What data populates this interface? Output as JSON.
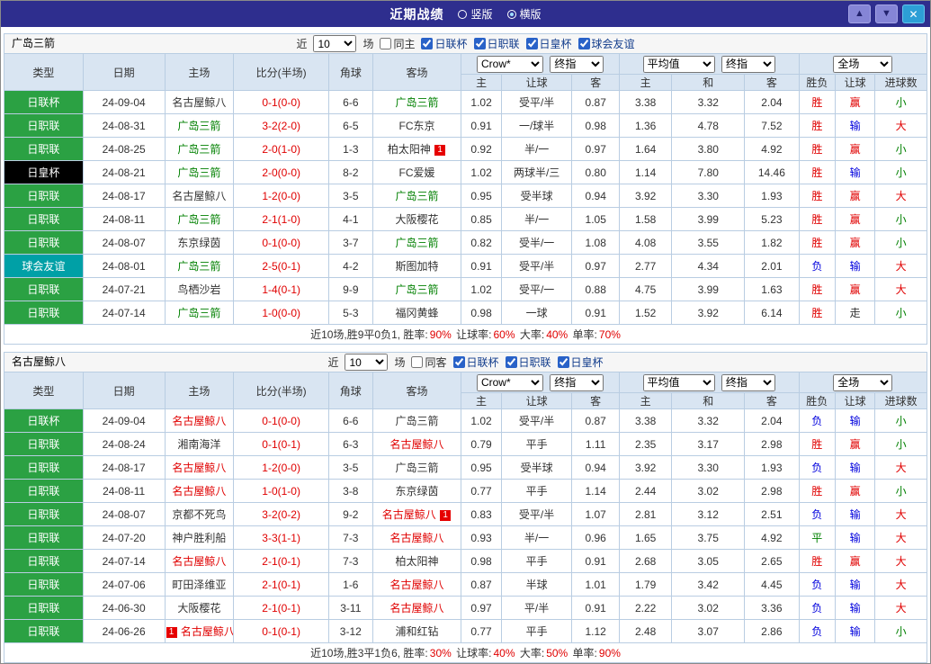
{
  "topbar": {
    "title": "近期战绩",
    "radio_vertical": "竖版",
    "radio_horizontal": "横版",
    "selected_radio": "横版",
    "up_icon": "▲",
    "down_icon": "▼",
    "close_icon": "✕"
  },
  "colors": {
    "titlebar_bg": "#2e2e8e",
    "header_bg": "#d9e5f2",
    "win_red": "#e00000",
    "loss_blue": "#0000dd",
    "draw_green": "#008000",
    "league_green": "#2ba143",
    "cup_black": "#000000",
    "friendly_teal": "#00a0a6"
  },
  "shared": {
    "near_label": "近",
    "near_value": "10",
    "matches_label": "场",
    "dropdowns": [
      "Crow*",
      "终指",
      "平均值",
      "终指",
      "全场"
    ],
    "columns": [
      "类型",
      "日期",
      "主场",
      "比分(半场)",
      "角球",
      "客场"
    ],
    "odds_columns": [
      "主",
      "让球",
      "客",
      "主",
      "和",
      "客"
    ],
    "result_columns": [
      "胜负",
      "让球",
      "进球数"
    ]
  },
  "tables": [
    {
      "team": "广岛三箭",
      "same_side_label": "同主",
      "same_side_checked": false,
      "league_filters": [
        {
          "label": "日联杯",
          "checked": true
        },
        {
          "label": "日职联",
          "checked": true
        },
        {
          "label": "日皇杯",
          "checked": true
        },
        {
          "label": "球会友谊",
          "checked": true
        }
      ],
      "rows": [
        {
          "type": "日联杯",
          "type_bg": "#2ba143",
          "date": "24-09-04",
          "home": "名古屋鲸八",
          "home_color": "#333333",
          "score": "0-1(0-0)",
          "corner": "6-6",
          "away": "广岛三箭",
          "away_color": "#008000",
          "odds": [
            "1.02",
            "受平/半",
            "0.87",
            "3.38",
            "3.32",
            "2.04"
          ],
          "result": "胜",
          "result_color": "#e00000",
          "cover": "赢",
          "cover_color": "#e00000",
          "goals": "小",
          "goals_color": "#008000"
        },
        {
          "type": "日职联",
          "type_bg": "#2ba143",
          "date": "24-08-31",
          "home": "广岛三箭",
          "home_color": "#008000",
          "score": "3-2(2-0)",
          "corner": "6-5",
          "away": "FC东京",
          "away_color": "#333333",
          "odds": [
            "0.91",
            "一/球半",
            "0.98",
            "1.36",
            "4.78",
            "7.52"
          ],
          "result": "胜",
          "result_color": "#e00000",
          "cover": "输",
          "cover_color": "#0000dd",
          "goals": "大",
          "goals_color": "#e00000"
        },
        {
          "type": "日职联",
          "type_bg": "#2ba143",
          "date": "24-08-25",
          "home": "广岛三箭",
          "home_color": "#008000",
          "score": "2-0(1-0)",
          "corner": "1-3",
          "away": "柏太阳神",
          "away_color": "#333333",
          "away_badge": {
            "text": "1",
            "pos": "after"
          },
          "odds": [
            "0.92",
            "半/一",
            "0.97",
            "1.64",
            "3.80",
            "4.92"
          ],
          "result": "胜",
          "result_color": "#e00000",
          "cover": "赢",
          "cover_color": "#e00000",
          "goals": "小",
          "goals_color": "#008000"
        },
        {
          "type": "日皇杯",
          "type_bg": "#000000",
          "date": "24-08-21",
          "home": "广岛三箭",
          "home_color": "#008000",
          "score": "2-0(0-0)",
          "corner": "8-2",
          "away": "FC爱媛",
          "away_color": "#333333",
          "odds": [
            "1.02",
            "两球半/三",
            "0.80",
            "1.14",
            "7.80",
            "14.46"
          ],
          "result": "胜",
          "result_color": "#e00000",
          "cover": "输",
          "cover_color": "#0000dd",
          "goals": "小",
          "goals_color": "#008000"
        },
        {
          "type": "日职联",
          "type_bg": "#2ba143",
          "date": "24-08-17",
          "home": "名古屋鲸八",
          "home_color": "#333333",
          "score": "1-2(0-0)",
          "corner": "3-5",
          "away": "广岛三箭",
          "away_color": "#008000",
          "odds": [
            "0.95",
            "受半球",
            "0.94",
            "3.92",
            "3.30",
            "1.93"
          ],
          "result": "胜",
          "result_color": "#e00000",
          "cover": "赢",
          "cover_color": "#e00000",
          "goals": "大",
          "goals_color": "#e00000"
        },
        {
          "type": "日职联",
          "type_bg": "#2ba143",
          "date": "24-08-11",
          "home": "广岛三箭",
          "home_color": "#008000",
          "score": "2-1(1-0)",
          "corner": "4-1",
          "away": "大阪樱花",
          "away_color": "#333333",
          "odds": [
            "0.85",
            "半/一",
            "1.05",
            "1.58",
            "3.99",
            "5.23"
          ],
          "result": "胜",
          "result_color": "#e00000",
          "cover": "赢",
          "cover_color": "#e00000",
          "goals": "小",
          "goals_color": "#008000"
        },
        {
          "type": "日职联",
          "type_bg": "#2ba143",
          "date": "24-08-07",
          "home": "东京绿茵",
          "home_color": "#333333",
          "score": "0-1(0-0)",
          "corner": "3-7",
          "away": "广岛三箭",
          "away_color": "#008000",
          "odds": [
            "0.82",
            "受半/一",
            "1.08",
            "4.08",
            "3.55",
            "1.82"
          ],
          "result": "胜",
          "result_color": "#e00000",
          "cover": "赢",
          "cover_color": "#e00000",
          "goals": "小",
          "goals_color": "#008000"
        },
        {
          "type": "球会友谊",
          "type_bg": "#00a0a6",
          "date": "24-08-01",
          "home": "广岛三箭",
          "home_color": "#008000",
          "score": "2-5(0-1)",
          "corner": "4-2",
          "away": "斯图加特",
          "away_color": "#333333",
          "odds": [
            "0.91",
            "受平/半",
            "0.97",
            "2.77",
            "4.34",
            "2.01"
          ],
          "result": "负",
          "result_color": "#0000dd",
          "cover": "输",
          "cover_color": "#0000dd",
          "goals": "大",
          "goals_color": "#e00000"
        },
        {
          "type": "日职联",
          "type_bg": "#2ba143",
          "date": "24-07-21",
          "home": "鸟栖沙岩",
          "home_color": "#333333",
          "score": "1-4(0-1)",
          "corner": "9-9",
          "away": "广岛三箭",
          "away_color": "#008000",
          "odds": [
            "1.02",
            "受平/一",
            "0.88",
            "4.75",
            "3.99",
            "1.63"
          ],
          "result": "胜",
          "result_color": "#e00000",
          "cover": "赢",
          "cover_color": "#e00000",
          "goals": "大",
          "goals_color": "#e00000"
        },
        {
          "type": "日职联",
          "type_bg": "#2ba143",
          "date": "24-07-14",
          "home": "广岛三箭",
          "home_color": "#008000",
          "score": "1-0(0-0)",
          "corner": "5-3",
          "away": "福冈黄蜂",
          "away_color": "#333333",
          "odds": [
            "0.98",
            "一球",
            "0.91",
            "1.52",
            "3.92",
            "6.14"
          ],
          "result": "胜",
          "result_color": "#e00000",
          "cover": "走",
          "cover_color": "#333333",
          "goals": "小",
          "goals_color": "#008000"
        }
      ],
      "summary": [
        {
          "text": "近10场,胜9平0负1, 胜率:",
          "color": "#333333"
        },
        {
          "text": "90%",
          "color": "#e00000"
        },
        {
          "text": " 让球率:",
          "color": "#333333"
        },
        {
          "text": "60%",
          "color": "#e00000"
        },
        {
          "text": " 大率:",
          "color": "#333333"
        },
        {
          "text": "40%",
          "color": "#e00000"
        },
        {
          "text": " 单率:",
          "color": "#333333"
        },
        {
          "text": "70%",
          "color": "#e00000"
        }
      ]
    },
    {
      "team": "名古屋鲸八",
      "same_side_label": "同客",
      "same_side_checked": false,
      "league_filters": [
        {
          "label": "日联杯",
          "checked": true
        },
        {
          "label": "日职联",
          "checked": true
        },
        {
          "label": "日皇杯",
          "checked": true
        }
      ],
      "rows": [
        {
          "type": "日联杯",
          "type_bg": "#2ba143",
          "date": "24-09-04",
          "home": "名古屋鲸八",
          "home_color": "#e00000",
          "score": "0-1(0-0)",
          "corner": "6-6",
          "away": "广岛三箭",
          "away_color": "#333333",
          "odds": [
            "1.02",
            "受平/半",
            "0.87",
            "3.38",
            "3.32",
            "2.04"
          ],
          "result": "负",
          "result_color": "#0000dd",
          "cover": "输",
          "cover_color": "#0000dd",
          "goals": "小",
          "goals_color": "#008000"
        },
        {
          "type": "日职联",
          "type_bg": "#2ba143",
          "date": "24-08-24",
          "home": "湘南海洋",
          "home_color": "#333333",
          "score": "0-1(0-1)",
          "corner": "6-3",
          "away": "名古屋鲸八",
          "away_color": "#e00000",
          "odds": [
            "0.79",
            "平手",
            "1.11",
            "2.35",
            "3.17",
            "2.98"
          ],
          "result": "胜",
          "result_color": "#e00000",
          "cover": "赢",
          "cover_color": "#e00000",
          "goals": "小",
          "goals_color": "#008000"
        },
        {
          "type": "日职联",
          "type_bg": "#2ba143",
          "date": "24-08-17",
          "home": "名古屋鲸八",
          "home_color": "#e00000",
          "score": "1-2(0-0)",
          "corner": "3-5",
          "away": "广岛三箭",
          "away_color": "#333333",
          "odds": [
            "0.95",
            "受半球",
            "0.94",
            "3.92",
            "3.30",
            "1.93"
          ],
          "result": "负",
          "result_color": "#0000dd",
          "cover": "输",
          "cover_color": "#0000dd",
          "goals": "大",
          "goals_color": "#e00000"
        },
        {
          "type": "日职联",
          "type_bg": "#2ba143",
          "date": "24-08-11",
          "home": "名古屋鲸八",
          "home_color": "#e00000",
          "score": "1-0(1-0)",
          "corner": "3-8",
          "away": "东京绿茵",
          "away_color": "#333333",
          "odds": [
            "0.77",
            "平手",
            "1.14",
            "2.44",
            "3.02",
            "2.98"
          ],
          "result": "胜",
          "result_color": "#e00000",
          "cover": "赢",
          "cover_color": "#e00000",
          "goals": "小",
          "goals_color": "#008000"
        },
        {
          "type": "日职联",
          "type_bg": "#2ba143",
          "date": "24-08-07",
          "home": "京都不死鸟",
          "home_color": "#333333",
          "score": "3-2(0-2)",
          "corner": "9-2",
          "away": "名古屋鲸八",
          "away_color": "#e00000",
          "away_badge": {
            "text": "1",
            "pos": "after"
          },
          "odds": [
            "0.83",
            "受平/半",
            "1.07",
            "2.81",
            "3.12",
            "2.51"
          ],
          "result": "负",
          "result_color": "#0000dd",
          "cover": "输",
          "cover_color": "#0000dd",
          "goals": "大",
          "goals_color": "#e00000"
        },
        {
          "type": "日职联",
          "type_bg": "#2ba143",
          "date": "24-07-20",
          "home": "神户胜利船",
          "home_color": "#333333",
          "score": "3-3(1-1)",
          "corner": "7-3",
          "away": "名古屋鲸八",
          "away_color": "#e00000",
          "odds": [
            "0.93",
            "半/一",
            "0.96",
            "1.65",
            "3.75",
            "4.92"
          ],
          "result": "平",
          "result_color": "#008000",
          "cover": "输",
          "cover_color": "#0000dd",
          "goals": "大",
          "goals_color": "#e00000"
        },
        {
          "type": "日职联",
          "type_bg": "#2ba143",
          "date": "24-07-14",
          "home": "名古屋鲸八",
          "home_color": "#e00000",
          "score": "2-1(0-1)",
          "corner": "7-3",
          "away": "柏太阳神",
          "away_color": "#333333",
          "odds": [
            "0.98",
            "平手",
            "0.91",
            "2.68",
            "3.05",
            "2.65"
          ],
          "result": "胜",
          "result_color": "#e00000",
          "cover": "赢",
          "cover_color": "#e00000",
          "goals": "大",
          "goals_color": "#e00000"
        },
        {
          "type": "日职联",
          "type_bg": "#2ba143",
          "date": "24-07-06",
          "home": "町田泽维亚",
          "home_color": "#333333",
          "score": "2-1(0-1)",
          "corner": "1-6",
          "away": "名古屋鲸八",
          "away_color": "#e00000",
          "odds": [
            "0.87",
            "半球",
            "1.01",
            "1.79",
            "3.42",
            "4.45"
          ],
          "result": "负",
          "result_color": "#0000dd",
          "cover": "输",
          "cover_color": "#0000dd",
          "goals": "大",
          "goals_color": "#e00000"
        },
        {
          "type": "日职联",
          "type_bg": "#2ba143",
          "date": "24-06-30",
          "home": "大阪樱花",
          "home_color": "#333333",
          "score": "2-1(0-1)",
          "corner": "3-11",
          "away": "名古屋鲸八",
          "away_color": "#e00000",
          "odds": [
            "0.97",
            "平/半",
            "0.91",
            "2.22",
            "3.02",
            "3.36"
          ],
          "result": "负",
          "result_color": "#0000dd",
          "cover": "输",
          "cover_color": "#0000dd",
          "goals": "大",
          "goals_color": "#e00000"
        },
        {
          "type": "日职联",
          "type_bg": "#2ba143",
          "date": "24-06-26",
          "home": "名古屋鲸八",
          "home_color": "#e00000",
          "home_badge": {
            "text": "1",
            "pos": "before"
          },
          "score": "0-1(0-1)",
          "corner": "3-12",
          "away": "浦和红钻",
          "away_color": "#333333",
          "odds": [
            "0.77",
            "平手",
            "1.12",
            "2.48",
            "3.07",
            "2.86"
          ],
          "result": "负",
          "result_color": "#0000dd",
          "cover": "输",
          "cover_color": "#0000dd",
          "goals": "小",
          "goals_color": "#008000"
        }
      ],
      "summary": [
        {
          "text": "近10场,胜3平1负6, 胜率:",
          "color": "#333333"
        },
        {
          "text": "30%",
          "color": "#e00000"
        },
        {
          "text": " 让球率:",
          "color": "#333333"
        },
        {
          "text": "40%",
          "color": "#e00000"
        },
        {
          "text": " 大率:",
          "color": "#333333"
        },
        {
          "text": "50%",
          "color": "#e00000"
        },
        {
          "text": " 单率:",
          "color": "#333333"
        },
        {
          "text": "90%",
          "color": "#e00000"
        }
      ]
    }
  ]
}
